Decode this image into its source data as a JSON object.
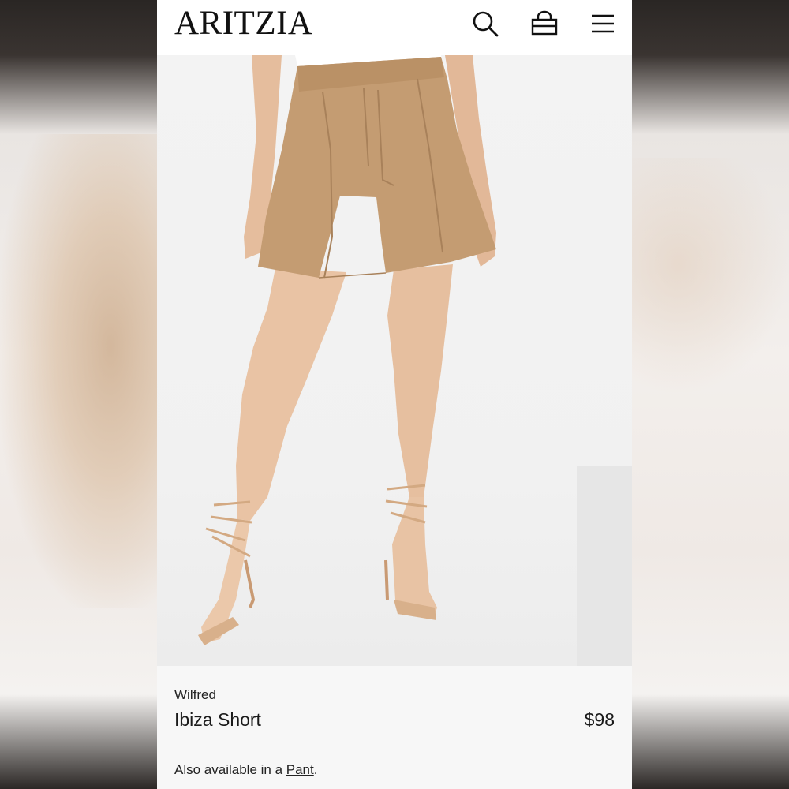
{
  "header": {
    "logo_text": "ARITZIA",
    "icons": [
      "search-icon",
      "shopping-bag-icon",
      "menu-icon"
    ]
  },
  "product": {
    "image_description_icon": "product-photo",
    "brand": "Wilfred",
    "name": "Ibiza Short",
    "price": "$98",
    "also_available_prefix": "Also available in a ",
    "also_available_link": "Pant",
    "also_available_suffix": "."
  },
  "colors": {
    "short": "#c49c72",
    "skin": "#e8c1a2",
    "header_bg": "#ffffff",
    "text": "#1a1a1a"
  }
}
